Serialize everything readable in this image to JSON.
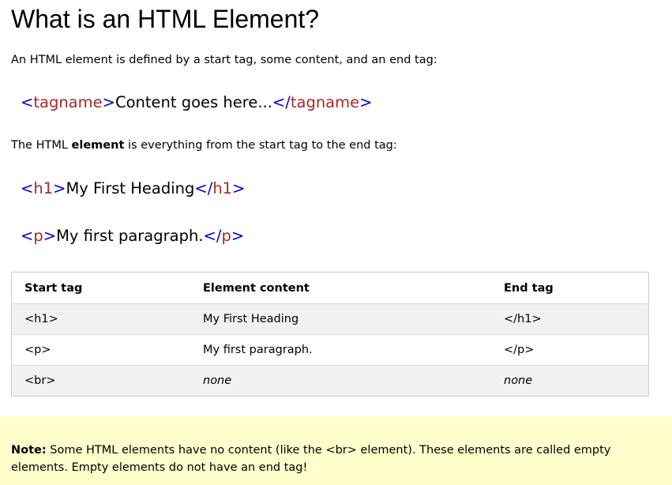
{
  "heading": "What is an HTML Element?",
  "intro": "An HTML element is defined by a start tag, some content, and an end tag:",
  "syntax_example": {
    "open_lt": "<",
    "open_name": "tagname",
    "open_gt": ">",
    "content": "Content goes here...",
    "close_lt": "</",
    "close_name": "tagname",
    "close_gt": ">"
  },
  "description": {
    "before": "The HTML ",
    "bold": "element",
    "after": " is everything from the start tag to the end tag:"
  },
  "examples": [
    {
      "open_lt": "<",
      "open_name": "h1",
      "open_gt": ">",
      "content": "My First Heading",
      "close_lt": "</",
      "close_name": "h1",
      "close_gt": ">"
    },
    {
      "open_lt": "<",
      "open_name": "p",
      "open_gt": ">",
      "content": "My first paragraph.",
      "close_lt": "</",
      "close_name": "p",
      "close_gt": ">"
    }
  ],
  "table": {
    "headers": [
      "Start tag",
      "Element content",
      "End tag"
    ],
    "rows": [
      [
        "<h1>",
        "My First Heading",
        "</h1>"
      ],
      [
        "<p>",
        "My first paragraph.",
        "</p>"
      ],
      [
        "<br>",
        "none",
        "none"
      ]
    ]
  },
  "note": {
    "label": "Note:",
    "text": " Some HTML elements have no content (like the <br> element). These elements are called empty elements. Empty elements do not have an end tag!"
  },
  "colors": {
    "bracket": "#0000cd",
    "tag_name": "#a52a2a",
    "note_background": "#ffffcc",
    "table_alt_row": "#f1f1f1"
  }
}
